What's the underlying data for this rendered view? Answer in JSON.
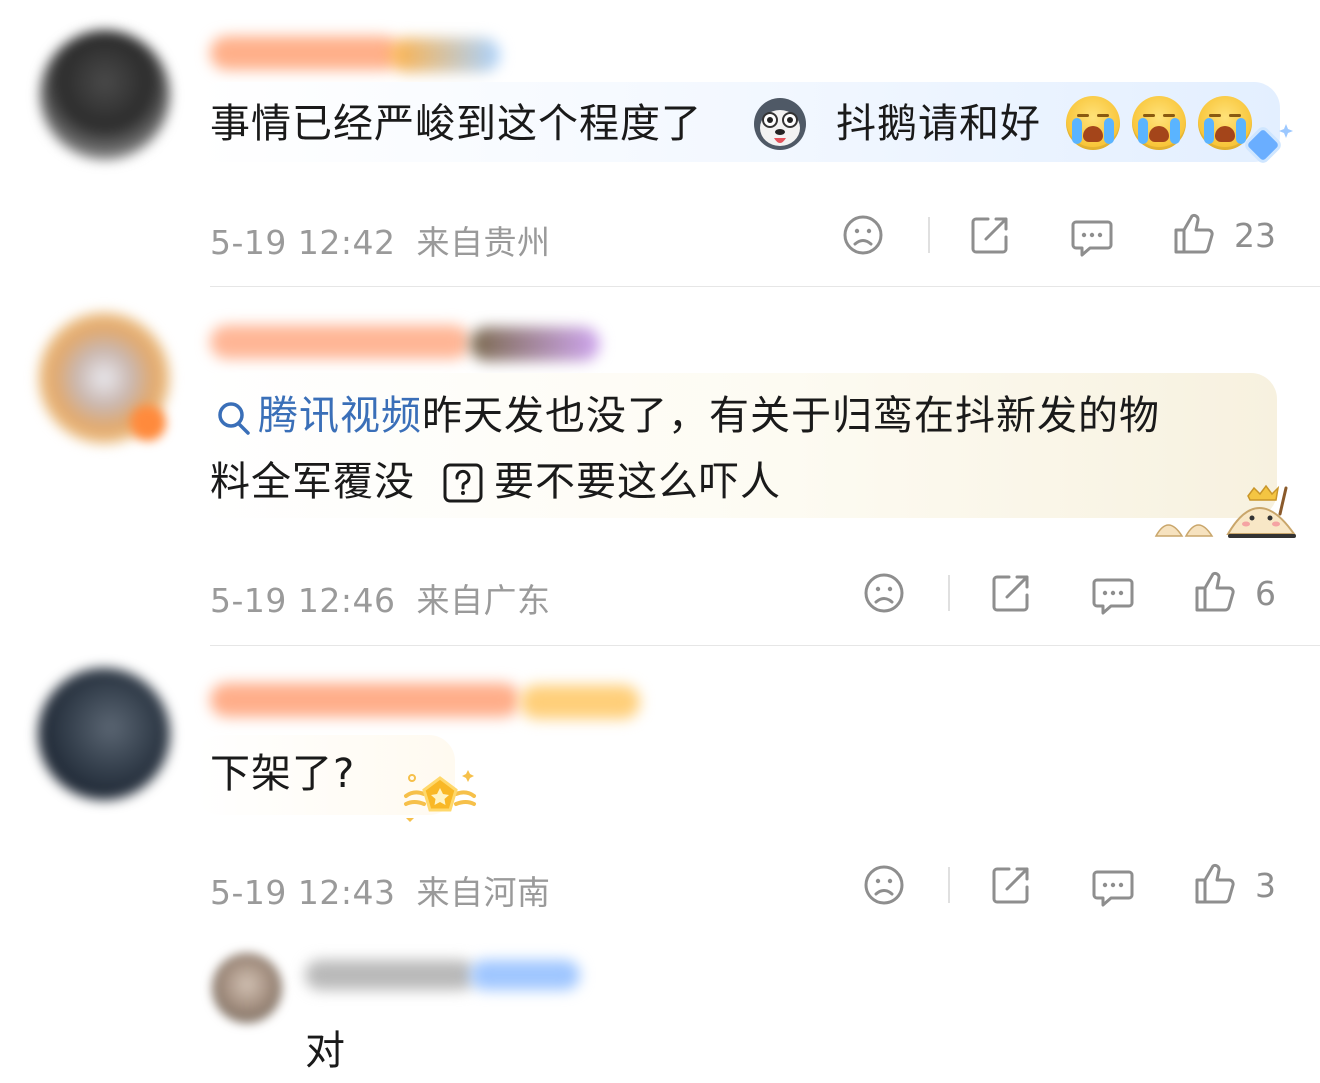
{
  "comments": [
    {
      "text_before": "事情已经严峻到这个程度了",
      "text_after": "抖鹅请和好",
      "emoji_1": "husky-emoji",
      "emoji_2": "crying-emoji",
      "date": "5-19 12:42",
      "location": "来自贵州",
      "likes": "23"
    },
    {
      "link": "腾讯视频",
      "line1": "昨天发也没了，有关于归鸾在抖新发的物",
      "line2_before": "料全军覆没",
      "line2_after": "要不要这么吓人",
      "date": "5-19 12:46",
      "location": "来自广东",
      "likes": "6"
    },
    {
      "text": "下架了?",
      "date": "5-19 12:43",
      "location": "来自河南",
      "likes": "3"
    }
  ],
  "reply": {
    "text": "对"
  },
  "icons": {
    "dislike": "sad-face-icon",
    "share": "share-icon",
    "comment": "comment-bubble-icon",
    "like": "thumbs-up-icon",
    "search": "search-icon",
    "question": "question-box-icon"
  },
  "colors": {
    "link": "#3a6fb8",
    "meta": "#9a9a9a",
    "text": "#1a1a1a"
  }
}
